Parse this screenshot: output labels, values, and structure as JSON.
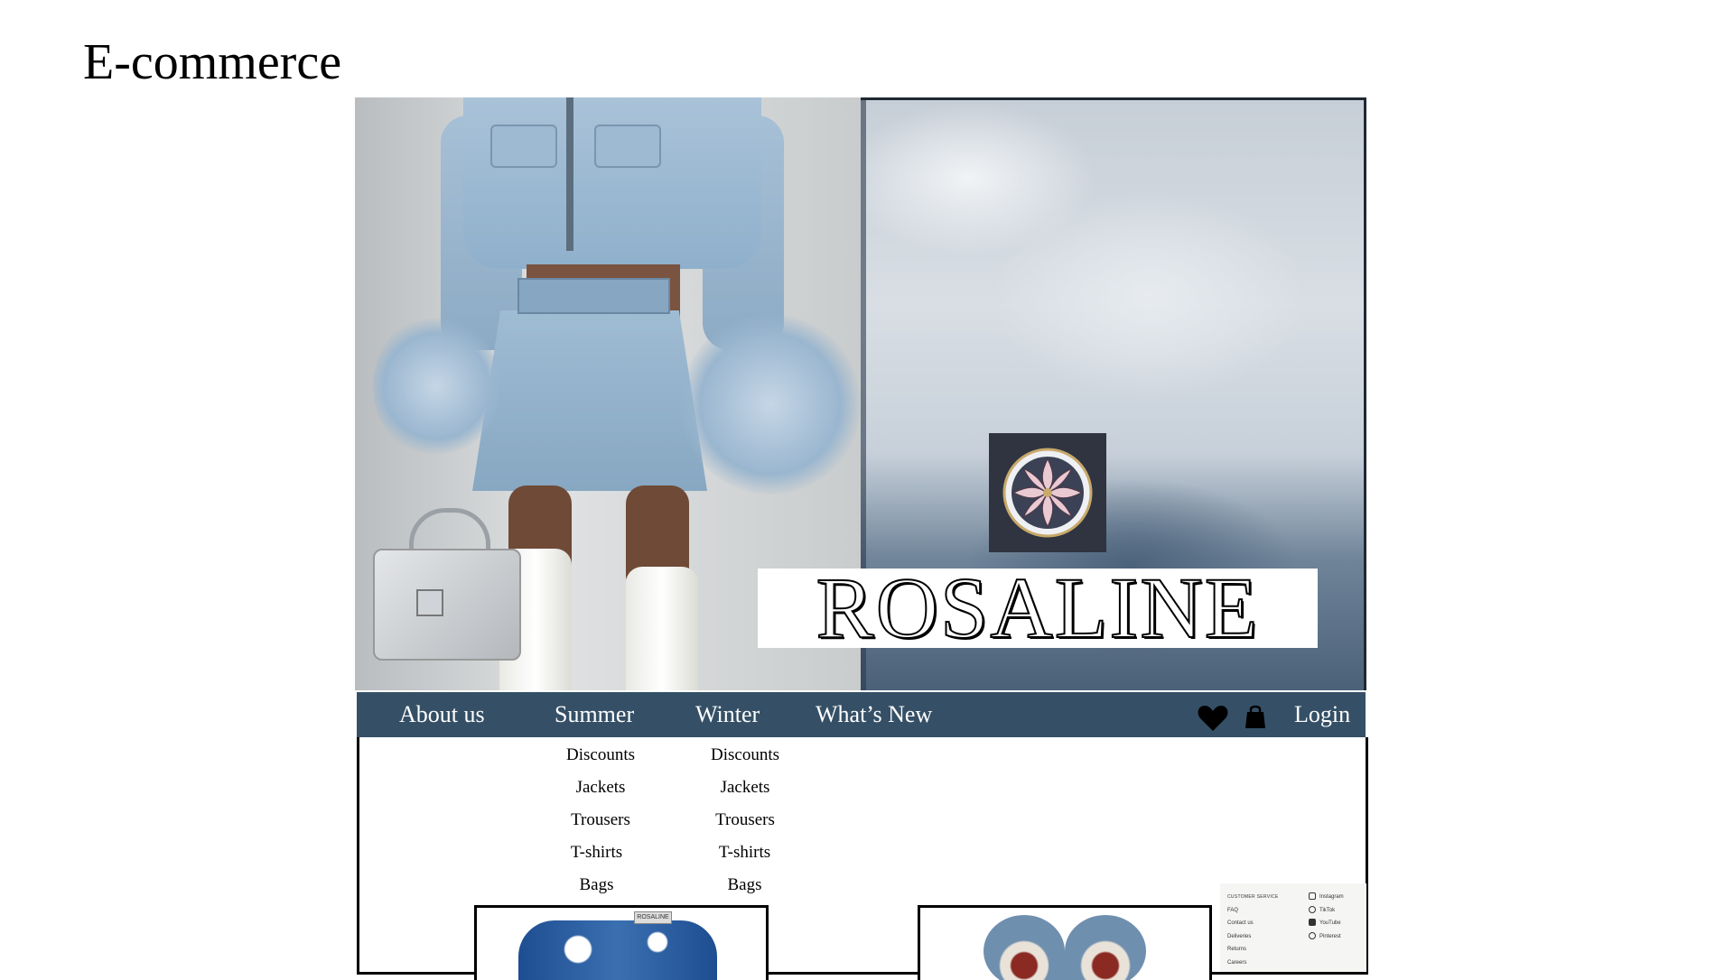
{
  "slide": {
    "title": "E-commerce"
  },
  "brand": {
    "name": "ROSALINE",
    "logo_icon": "lotus-mandala-icon"
  },
  "nav": {
    "items": [
      "About us",
      "Summer",
      "Winter",
      "What’s New"
    ],
    "icons": [
      "heart-icon",
      "shopping-bag-icon"
    ],
    "login": "Login",
    "bar_color": "#355066"
  },
  "menus": {
    "summer": [
      "Discounts",
      "Jackets",
      "Trousers",
      "T-shirts",
      "Bags"
    ],
    "winter": [
      "Discounts",
      "Jackets",
      "Trousers",
      "T-shirts",
      "Bags"
    ]
  },
  "footer": {
    "customer_service": {
      "heading": "CUSTOMER SERVICE",
      "links": [
        "FAQ",
        "Contact us",
        "Deliveries",
        "Returns",
        "Careers"
      ]
    },
    "social": [
      {
        "label": "Instagram",
        "icon": "instagram-icon"
      },
      {
        "label": "TikTok",
        "icon": "tiktok-icon"
      },
      {
        "label": "YouTube",
        "icon": "youtube-icon"
      },
      {
        "label": "Pinterest",
        "icon": "pinterest-icon"
      }
    ]
  },
  "products": {
    "shirt_tag": "ROSALINE"
  }
}
